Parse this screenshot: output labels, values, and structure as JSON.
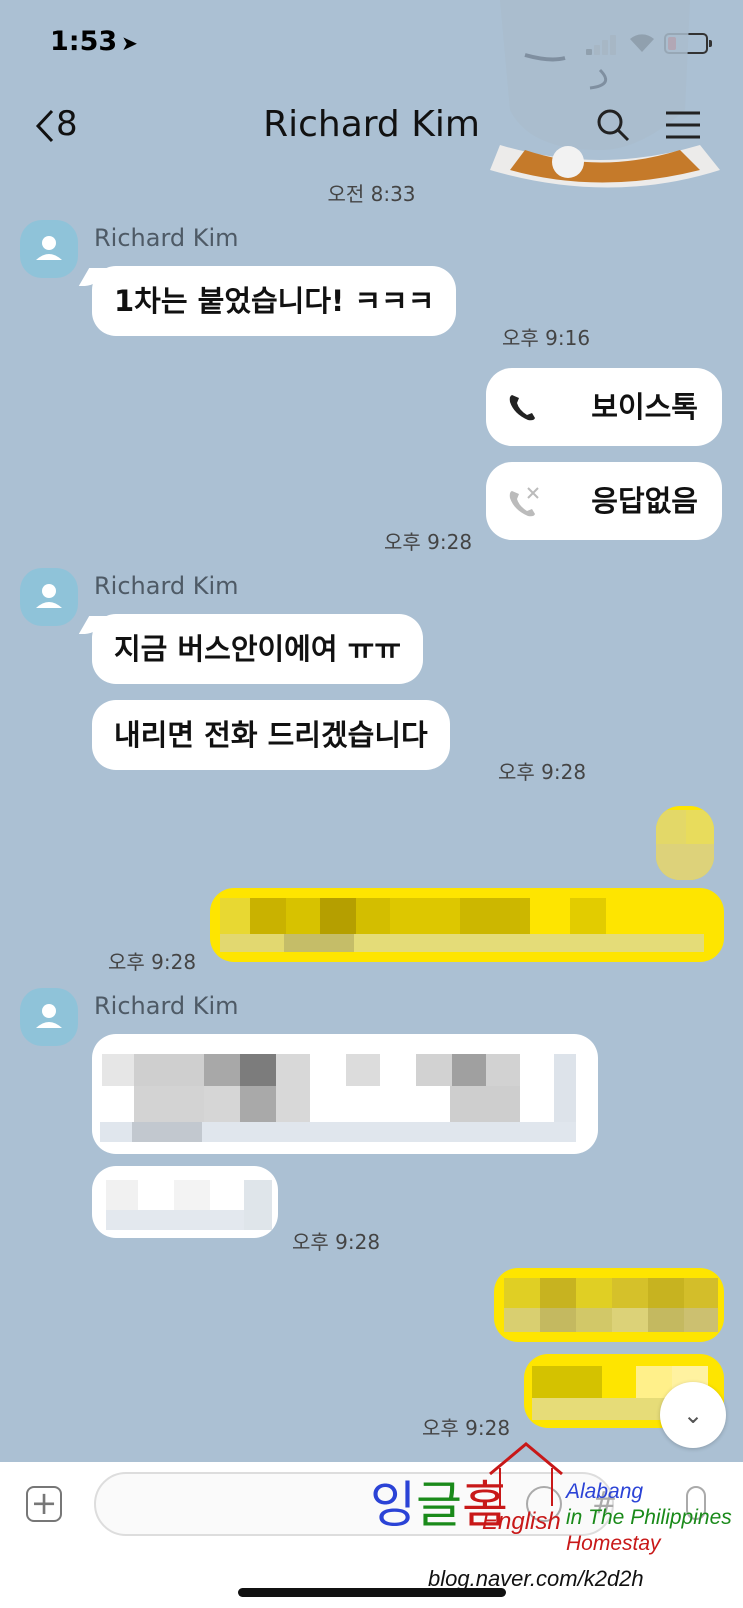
{
  "status_bar": {
    "time": "1:53",
    "location_icon": "location-arrow-icon",
    "battery_color": "#e52f2f"
  },
  "header": {
    "back_count": "8",
    "title": "Richard Kim"
  },
  "messages": {
    "morning_time": "오전 8:33",
    "group1": {
      "sender": "Richard Kim",
      "text": "1차는 붙었습니다! ㅋㅋㅋ",
      "time": "오후 9:16"
    },
    "calls": {
      "voice_label": "보이스톡",
      "missed_label": "응답없음",
      "time": "오후 9:28"
    },
    "group2": {
      "sender": "Richard Kim",
      "text1": "지금 버스안이에여 ㅠㅠ",
      "text2": "내리면 전화 드리겠습니다",
      "time": "오후 9:28"
    },
    "mine1": {
      "time": "오후 9:28"
    },
    "group3": {
      "sender": "Richard Kim",
      "time": "오후 9:28"
    },
    "mine2": {
      "time": "오후 9:28"
    }
  },
  "watermark": {
    "korean": "잉글홈",
    "english": "English",
    "alabang": "Alabang",
    "philippines": "in The Philippines",
    "homestay": "Homestay",
    "url": "blog.naver.com/k2d2h"
  },
  "colors": {
    "background": "#abc0d3",
    "my_bubble": "#fee500",
    "their_bubble": "#ffffff"
  }
}
